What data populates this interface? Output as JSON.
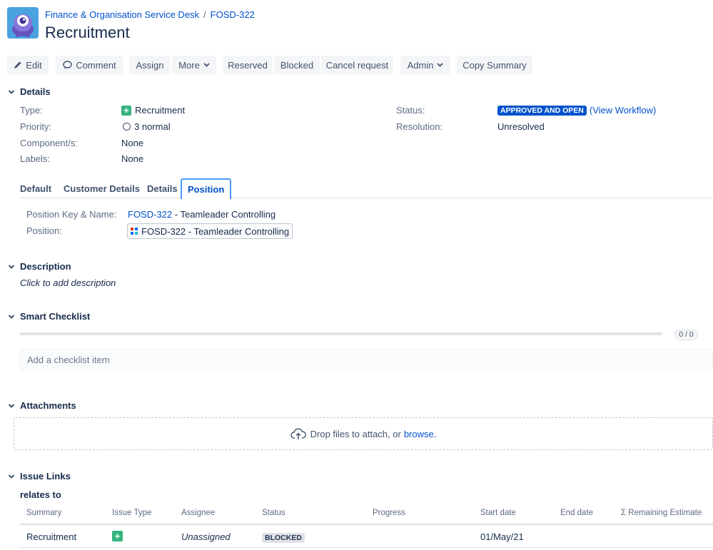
{
  "header": {
    "breadcrumb": [
      "Finance & Organisation Service Desk",
      "FOSD-322"
    ],
    "breadcrumb_separator": "/",
    "title": "Recruitment"
  },
  "toolbar": {
    "edit": "Edit",
    "comment": "Comment",
    "assign": "Assign",
    "more": "More",
    "reserved": "Reserved",
    "blocked": "Blocked",
    "cancel_request": "Cancel request",
    "admin": "Admin",
    "copy_summary": "Copy Summary"
  },
  "details": {
    "heading": "Details",
    "type_label": "Type:",
    "type_value": "Recruitment",
    "priority_label": "Priority:",
    "priority_value": "3 normal",
    "components_label": "Component/s:",
    "components_value": "None",
    "labels_label": "Labels:",
    "labels_value": "None",
    "status_label": "Status:",
    "status_value": "APPROVED AND OPEN",
    "view_workflow": "(View Workflow)",
    "resolution_label": "Resolution:",
    "resolution_value": "Unresolved"
  },
  "tabs": [
    "Default",
    "Customer Details",
    "Details",
    "Position"
  ],
  "position_tab": {
    "key_name_label": "Position Key & Name:",
    "key_link": "FOSD-322",
    "key_name_rest": " - Teamleader Controlling",
    "position_label": "Position:",
    "position_chip": "FOSD-322 - Teamleader Controlling"
  },
  "description": {
    "heading": "Description",
    "placeholder": "Click to add description"
  },
  "smart_checklist": {
    "heading": "Smart Checklist",
    "count": "0 / 0",
    "progress": 0,
    "input_placeholder": "Add a checklist item"
  },
  "attachments": {
    "heading": "Attachments",
    "drop_text": "Drop files to attach, or",
    "browse": "browse."
  },
  "issue_links": {
    "heading": "Issue Links",
    "relation": "relates to",
    "columns": [
      "Summary",
      "Issue Type",
      "Assignee",
      "Status",
      "Progress",
      "Start date",
      "End date",
      "Σ Remaining Estimate"
    ],
    "row": {
      "summary": "Recruitment",
      "assignee": "Unassigned",
      "status": "BLOCKED",
      "start_date": "01/May/21"
    }
  },
  "colors": {
    "link": "#0052cc",
    "status_approved": "#0052cc",
    "type_green": "#36b37e",
    "text": "#172b4d"
  }
}
